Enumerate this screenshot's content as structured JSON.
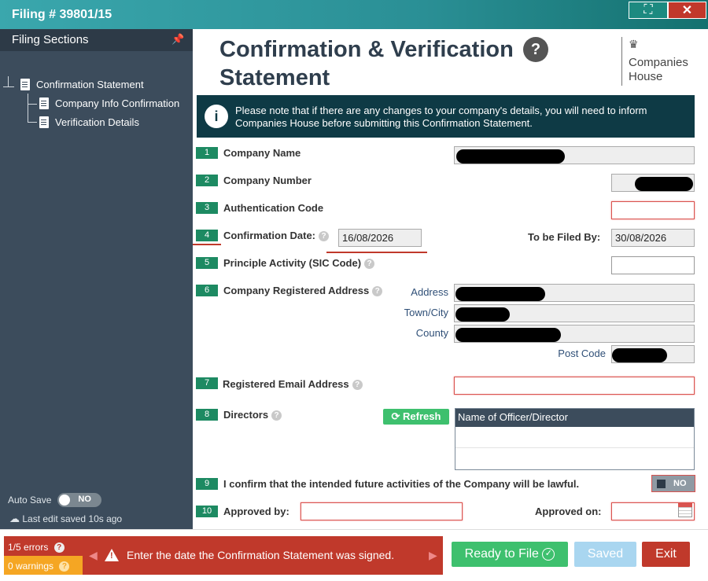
{
  "window": {
    "title": "Filing # 39801/15",
    "maximize_icon": "⛶",
    "close_icon": "✕"
  },
  "sidebar": {
    "title": "Filing Sections",
    "pin_icon": "📌",
    "collapse_icon": "»",
    "tree": {
      "root": "Confirmation Statement",
      "children": [
        "Company Info Confirmation",
        "Verification Details"
      ]
    },
    "autosave_label": "Auto Save",
    "autosave_state": "NO",
    "last_edit": "Last edit saved 10s ago"
  },
  "main": {
    "heading_line1": "Confirmation & Verification",
    "heading_line2": "Statement",
    "help_icon": "?",
    "logo_line1": "Companies",
    "logo_line2": "House",
    "logo_crest_icon": "♛",
    "notice_icon": "i",
    "notice_line1": "Please note that if there are any changes to your company's details, you will need to inform",
    "notice_line2": "Companies House before submitting this Confirmation Statement."
  },
  "fields": {
    "f1": {
      "num": "1",
      "label": "Company Name"
    },
    "f2": {
      "num": "2",
      "label": "Company Number"
    },
    "f3": {
      "num": "3",
      "label": "Authentication Code"
    },
    "f4": {
      "num": "4",
      "label": "Confirmation Date:",
      "value": "16/08/2026",
      "filed_label": "To be Filed By:",
      "filed_value": "30/08/2026"
    },
    "f5": {
      "num": "5",
      "label": "Principle Activity (SIC Code)"
    },
    "f6": {
      "num": "6",
      "label": "Company Registered Address",
      "address": "Address",
      "town": "Town/City",
      "county": "County",
      "postcode": "Post Code"
    },
    "f7": {
      "num": "7",
      "label": "Registered Email Address"
    },
    "f8": {
      "num": "8",
      "label": "Directors",
      "refresh": "Refresh",
      "refresh_icon": "⟳",
      "col_header": "Name of Officer/Director"
    },
    "f9": {
      "num": "9",
      "label": "I confirm that the intended future activities of the Company will be lawful.",
      "toggle": "NO"
    },
    "f10": {
      "num": "10",
      "label": "Approved by:",
      "approved_on": "Approved on:"
    }
  },
  "footer": {
    "errors": "1/5 errors",
    "warnings": "0 warnings",
    "error_message": "Enter the date the Confirmation Statement was signed.",
    "ready": "Ready to File",
    "ready_icon": "✓",
    "saved": "Saved",
    "exit": "Exit",
    "prev_icon": "◀",
    "next_icon": "▶"
  }
}
